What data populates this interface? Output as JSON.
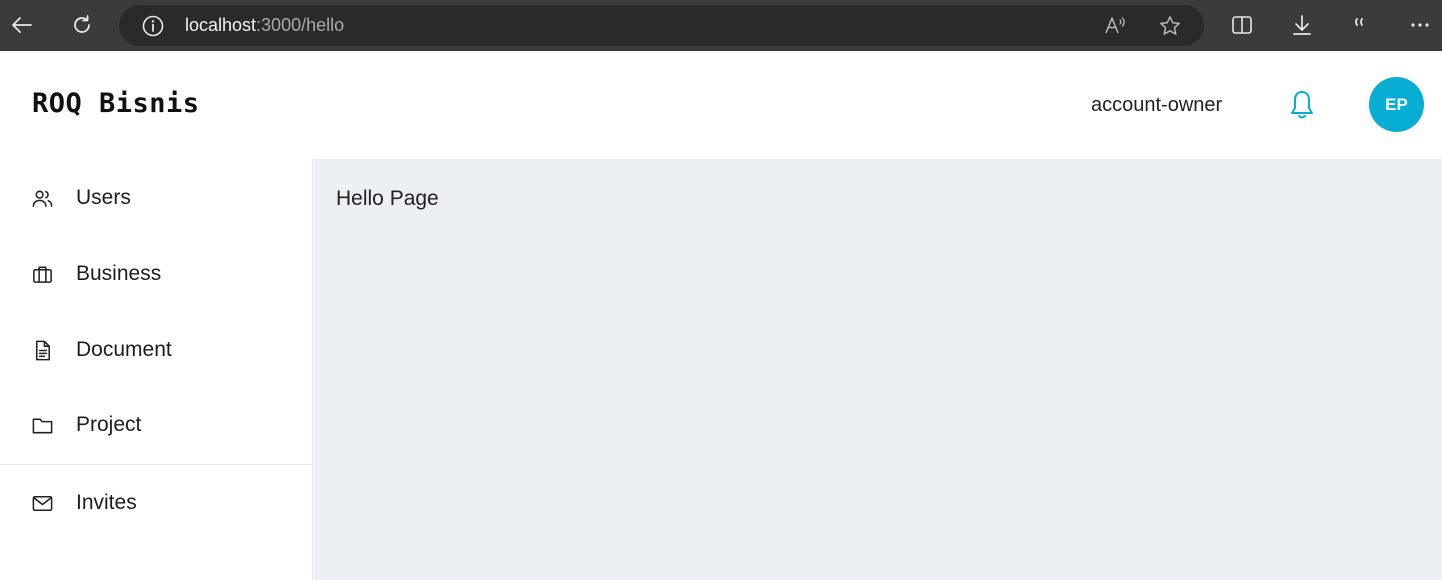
{
  "browser": {
    "url_host": "localhost",
    "url_path": ":3000/hello",
    "read_aloud_label": "A͡"
  },
  "header": {
    "brand": "ROQ Bisnis",
    "role": "account-owner",
    "avatar_initials": "EP"
  },
  "sidebar": {
    "items": [
      {
        "label": "Users",
        "icon": "users-icon"
      },
      {
        "label": "Business",
        "icon": "briefcase-icon"
      },
      {
        "label": "Document",
        "icon": "document-icon"
      },
      {
        "label": "Project",
        "icon": "folder-icon"
      },
      {
        "label": "Invites",
        "icon": "mail-icon"
      }
    ]
  },
  "main": {
    "text": "Hello Page"
  },
  "colors": {
    "accent": "#05aed2",
    "main_background": "#ecf0f4",
    "browser_bar": "#3b3b3b"
  }
}
